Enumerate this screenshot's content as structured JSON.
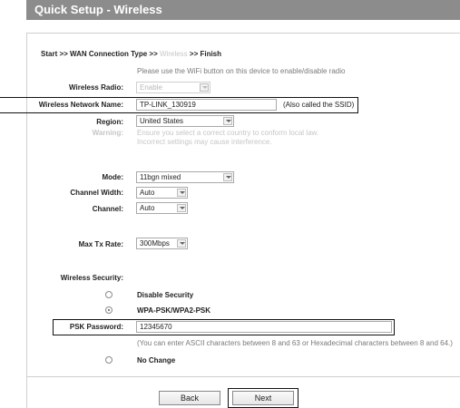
{
  "header": {
    "title": "Quick Setup - Wireless"
  },
  "breadcrumb": {
    "part1": "Start >> WAN Connection Type >> ",
    "current": "Wireless",
    "part2": " >> Finish"
  },
  "wireless": {
    "wifi_note": "Please use the WiFi button on this device to enable/disable radio",
    "radio_label": "Wireless Radio:",
    "radio_value": "Enable",
    "network_name_label": "Wireless Network Name:",
    "network_name_value": "TP-LINK_130919",
    "ssid_note": "(Also called the SSID)",
    "region_label": "Region:",
    "region_value": "United States",
    "warning_label": "Warning:",
    "warning_line1": "Ensure you select a correct country to conform local law.",
    "warning_line2": "Incorrect settings may cause interference.",
    "mode_label": "Mode:",
    "mode_value": "11bgn mixed",
    "channel_width_label": "Channel Width:",
    "channel_width_value": "Auto",
    "channel_label": "Channel:",
    "channel_value": "Auto",
    "tx_rate_label": "Max Tx Rate:",
    "tx_rate_value": "300Mbps"
  },
  "security": {
    "label": "Wireless Security:",
    "option_disable": "Disable Security",
    "option_wpa": "WPA-PSK/WPA2-PSK",
    "psk_label": "PSK Password:",
    "psk_value": "12345670",
    "psk_note": "(You can enter ASCII characters between 8 and 63 or Hexadecimal characters between 8 and 64.)",
    "option_nochange": "No Change"
  },
  "buttons": {
    "back": "Back",
    "next": "Next"
  },
  "colors": {
    "title_bar": "#8c8c8c",
    "dim_text": "#c6c6c6",
    "highlight_border": "#111111"
  }
}
